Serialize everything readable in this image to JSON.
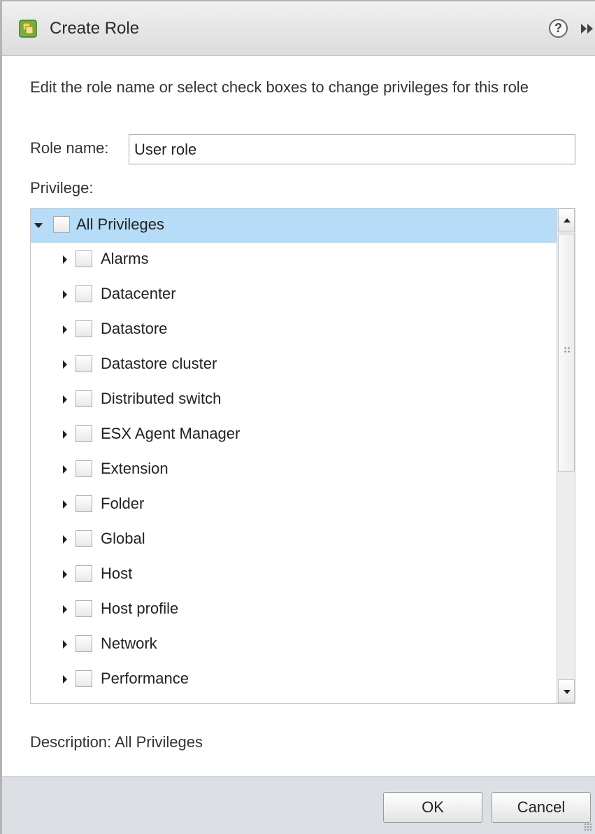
{
  "dialog": {
    "title": "Create Role",
    "help_icon": "?"
  },
  "instructions": "Edit the role name or select check boxes to change privileges for this role",
  "role_name": {
    "label": "Role name:",
    "value": "User role"
  },
  "privilege_label": "Privilege:",
  "tree": {
    "root": {
      "label": "All Privileges",
      "expanded": true,
      "checked": false,
      "selected": true
    },
    "items": [
      {
        "label": "Alarms",
        "checked": false
      },
      {
        "label": "Datacenter",
        "checked": false
      },
      {
        "label": "Datastore",
        "checked": false
      },
      {
        "label": "Datastore cluster",
        "checked": false
      },
      {
        "label": "Distributed switch",
        "checked": false
      },
      {
        "label": "ESX Agent Manager",
        "checked": false
      },
      {
        "label": "Extension",
        "checked": false
      },
      {
        "label": "Folder",
        "checked": false
      },
      {
        "label": "Global",
        "checked": false
      },
      {
        "label": "Host",
        "checked": false
      },
      {
        "label": "Host profile",
        "checked": false
      },
      {
        "label": "Network",
        "checked": false
      },
      {
        "label": "Performance",
        "checked": false
      }
    ]
  },
  "description": {
    "label": "Description:",
    "value": "All Privileges"
  },
  "buttons": {
    "ok": "OK",
    "cancel": "Cancel"
  },
  "colors": {
    "selected_row": "#b6dcf7",
    "footer": "#dcdfe3",
    "titlebar": "#e6e6e6"
  }
}
